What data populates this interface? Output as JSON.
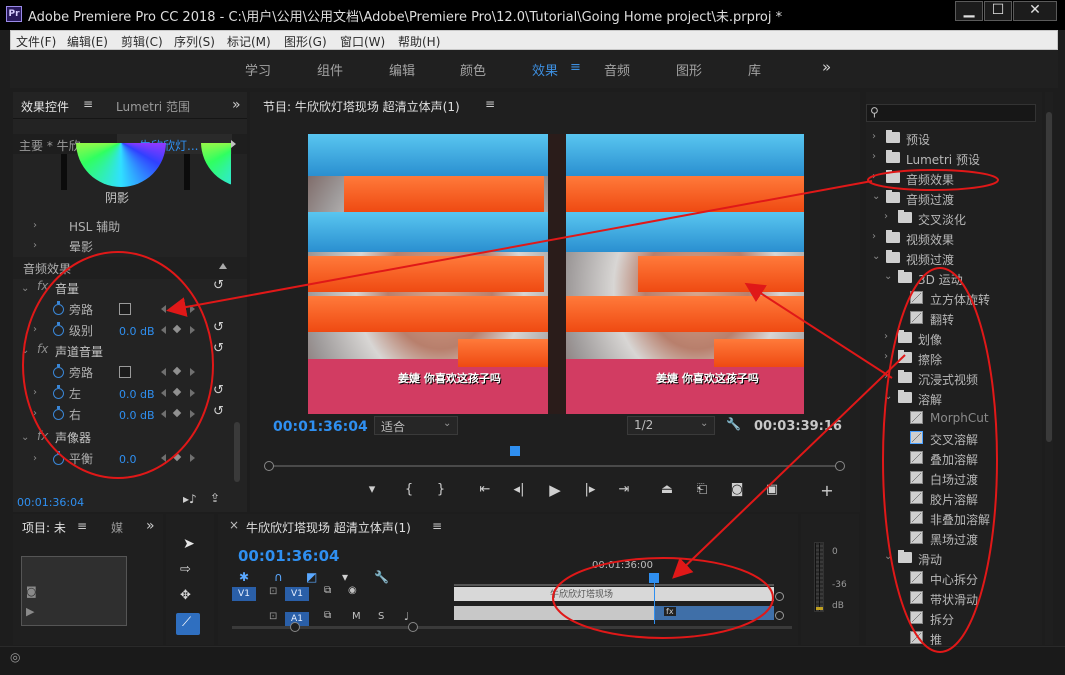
{
  "window": {
    "title": "Adobe Premiere Pro CC 2018 - C:\\用户\\公用\\公用文档\\Adobe\\Premiere Pro\\12.0\\Tutorial\\Going Home project\\未.prproj *",
    "logo": "Pr",
    "minimize": "▁",
    "maximize": "☐",
    "close": "✕"
  },
  "menu": [
    "文件(F)",
    "编辑(E)",
    "剪辑(C)",
    "序列(S)",
    "标记(M)",
    "图形(G)",
    "窗口(W)",
    "帮助(H)"
  ],
  "workspaces": {
    "tabs": [
      "学习",
      "组件",
      "编辑",
      "颜色",
      "效果",
      "音频",
      "图形",
      "库"
    ],
    "active": "效果",
    "more": "»"
  },
  "effect_controls": {
    "tab_active": "效果控件",
    "tab_other": "Lumetri 范围",
    "more": "»",
    "master": "主要 * 牛欣...",
    "clip": "牛欣欣灯...",
    "wheel_label": "阴影",
    "hsl": "HSL 辅助",
    "vignette": "晕影",
    "audio_section": "音频效果",
    "volume": {
      "name": "音量",
      "bypass": "旁路",
      "level_label": "级别",
      "level_value": "0.0 dB"
    },
    "channel_volume": {
      "name": "声道音量",
      "bypass": "旁路",
      "left_label": "左",
      "left_value": "0.0 dB",
      "right_label": "右",
      "right_value": "0.0 dB"
    },
    "panner": {
      "name": "声像器",
      "balance_label": "平衡",
      "balance_value": "0.0"
    },
    "fx_symbol": "fx",
    "timecode": "00:01:36:04"
  },
  "program": {
    "title": "节目: 牛欣欣灯塔现场 超清立体声(1)",
    "timecode": "00:01:36:04",
    "fit": "适合",
    "resolution": "1/2",
    "duration": "00:03:39:16",
    "caption": "姜婕 你喜欢这孩子吗",
    "playhead_fraction": 0.43
  },
  "effects_panel": {
    "items": [
      {
        "label": "预设",
        "type": "folder",
        "level": 0,
        "expanded": false
      },
      {
        "label": "Lumetri 预设",
        "type": "folder",
        "level": 0,
        "expanded": false
      },
      {
        "label": "音频效果",
        "type": "folder",
        "level": 0,
        "expanded": false
      },
      {
        "label": "音频过渡",
        "type": "folder",
        "level": 0,
        "expanded": true
      },
      {
        "label": "交叉淡化",
        "type": "folder",
        "level": 1,
        "expanded": false
      },
      {
        "label": "视频效果",
        "type": "folder",
        "level": 0,
        "expanded": false
      },
      {
        "label": "视频过渡",
        "type": "folder",
        "level": 0,
        "expanded": true
      },
      {
        "label": "3D 运动",
        "type": "folder",
        "level": 1,
        "expanded": true
      },
      {
        "label": "立方体旋转",
        "type": "fx",
        "level": 2
      },
      {
        "label": "翻转",
        "type": "fx",
        "level": 2
      },
      {
        "label": "划像",
        "type": "folder",
        "level": 1,
        "expanded": false
      },
      {
        "label": "擦除",
        "type": "folder",
        "level": 1,
        "expanded": false
      },
      {
        "label": "沉浸式视频",
        "type": "folder",
        "level": 1,
        "expanded": false
      },
      {
        "label": "溶解",
        "type": "folder",
        "level": 1,
        "expanded": true
      },
      {
        "label": "MorphCut",
        "type": "fx",
        "level": 2
      },
      {
        "label": "交叉溶解",
        "type": "fx",
        "level": 2,
        "selected": true
      },
      {
        "label": "叠加溶解",
        "type": "fx",
        "level": 2
      },
      {
        "label": "白场过渡",
        "type": "fx",
        "level": 2
      },
      {
        "label": "胶片溶解",
        "type": "fx",
        "level": 2
      },
      {
        "label": "非叠加溶解",
        "type": "fx",
        "level": 2
      },
      {
        "label": "黑场过渡",
        "type": "fx",
        "level": 2
      },
      {
        "label": "滑动",
        "type": "folder",
        "level": 1,
        "expanded": true
      },
      {
        "label": "中心拆分",
        "type": "fx",
        "level": 2
      },
      {
        "label": "带状滑动",
        "type": "fx",
        "level": 2
      },
      {
        "label": "拆分",
        "type": "fx",
        "level": 2
      },
      {
        "label": "推",
        "type": "fx",
        "level": 2
      }
    ]
  },
  "project": {
    "title": "项目: 未",
    "media_tab": "媒",
    "more": "»"
  },
  "timeline": {
    "close": "×",
    "title": "牛欣欣灯塔现场 超清立体声(1)",
    "timecode": "00:01:36:04",
    "ruler_time": "00:01:36:00",
    "v1_source": "V1",
    "v1": "V1",
    "a1": "A1",
    "video_clip": "牛欣欣灯塔现场",
    "audio_clip_fx": "fx"
  },
  "meter": {
    "labels": [
      "0",
      "-36",
      "dB"
    ]
  },
  "colors": {
    "accent": "#3d8fe0",
    "annotation": "#e01818",
    "timecode": "#2f8ff0"
  }
}
